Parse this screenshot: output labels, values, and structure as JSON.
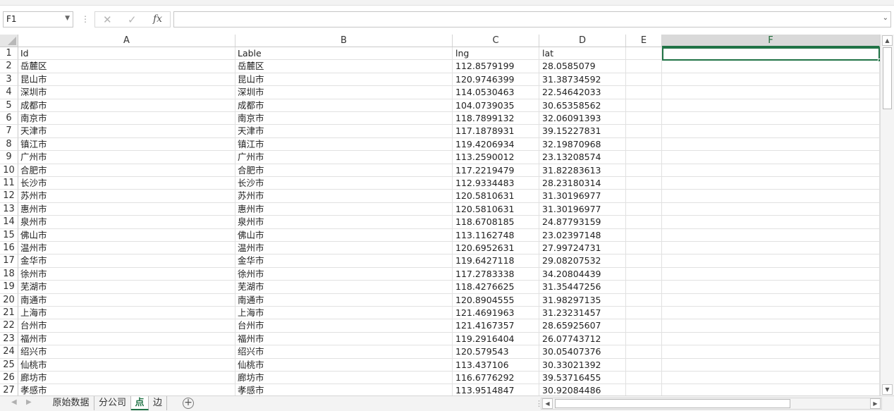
{
  "formula_bar": {
    "name_box": "F1",
    "fx_label": "fx",
    "formula_value": ""
  },
  "columns": [
    "A",
    "B",
    "C",
    "D",
    "E",
    "F"
  ],
  "active_column": "F",
  "rows": [
    {
      "num": "1",
      "a": "Id",
      "b": "Lable",
      "c": "lng",
      "d": "lat"
    },
    {
      "num": "2",
      "a": "岳麓区",
      "b": "岳麓区",
      "c": "112.8579199",
      "d": "28.0585079"
    },
    {
      "num": "3",
      "a": "昆山市",
      "b": "昆山市",
      "c": "120.9746399",
      "d": "31.38734592"
    },
    {
      "num": "4",
      "a": "深圳市",
      "b": "深圳市",
      "c": "114.0530463",
      "d": "22.54642033"
    },
    {
      "num": "5",
      "a": "成都市",
      "b": "成都市",
      "c": "104.0739035",
      "d": "30.65358562"
    },
    {
      "num": "6",
      "a": "南京市",
      "b": "南京市",
      "c": "118.7899132",
      "d": "32.06091393"
    },
    {
      "num": "7",
      "a": "天津市",
      "b": "天津市",
      "c": "117.1878931",
      "d": "39.15227831"
    },
    {
      "num": "8",
      "a": "镇江市",
      "b": "镇江市",
      "c": "119.4206934",
      "d": "32.19870968"
    },
    {
      "num": "9",
      "a": "广州市",
      "b": "广州市",
      "c": "113.2590012",
      "d": "23.13208574"
    },
    {
      "num": "10",
      "a": "合肥市",
      "b": "合肥市",
      "c": "117.2219479",
      "d": "31.82283613"
    },
    {
      "num": "11",
      "a": "长沙市",
      "b": "长沙市",
      "c": "112.9334483",
      "d": "28.23180314"
    },
    {
      "num": "12",
      "a": "苏州市",
      "b": "苏州市",
      "c": "120.5810631",
      "d": "31.30196977"
    },
    {
      "num": "13",
      "a": "惠州市",
      "b": "惠州市",
      "c": "120.5810631",
      "d": "31.30196977"
    },
    {
      "num": "14",
      "a": "泉州市",
      "b": "泉州市",
      "c": "118.6708185",
      "d": "24.87793159"
    },
    {
      "num": "15",
      "a": "佛山市",
      "b": "佛山市",
      "c": "113.1162748",
      "d": "23.02397148"
    },
    {
      "num": "16",
      "a": "温州市",
      "b": "温州市",
      "c": "120.6952631",
      "d": "27.99724731"
    },
    {
      "num": "17",
      "a": "金华市",
      "b": "金华市",
      "c": "119.6427118",
      "d": "29.08207532"
    },
    {
      "num": "18",
      "a": "徐州市",
      "b": "徐州市",
      "c": "117.2783338",
      "d": "34.20804439"
    },
    {
      "num": "19",
      "a": "芜湖市",
      "b": "芜湖市",
      "c": "118.4276625",
      "d": "31.35447256"
    },
    {
      "num": "20",
      "a": "南通市",
      "b": "南通市",
      "c": "120.8904555",
      "d": "31.98297135"
    },
    {
      "num": "21",
      "a": "上海市",
      "b": "上海市",
      "c": "121.4691963",
      "d": "31.23231457"
    },
    {
      "num": "22",
      "a": "台州市",
      "b": "台州市",
      "c": "121.4167357",
      "d": "28.65925607"
    },
    {
      "num": "23",
      "a": "福州市",
      "b": "福州市",
      "c": "119.2916404",
      "d": "26.07743712"
    },
    {
      "num": "24",
      "a": "绍兴市",
      "b": "绍兴市",
      "c": "120.579543",
      "d": "30.05407376"
    },
    {
      "num": "25",
      "a": "仙桃市",
      "b": "仙桃市",
      "c": "113.437106",
      "d": "30.33021392"
    },
    {
      "num": "26",
      "a": "廊坊市",
      "b": "廊坊市",
      "c": "116.6776292",
      "d": "39.53716455"
    },
    {
      "num": "27",
      "a": "孝感市",
      "b": "孝感市",
      "c": "113.9514847",
      "d": "30.92084486"
    }
  ],
  "sheet_tabs": [
    {
      "label": "原始数据",
      "active": false
    },
    {
      "label": "分公司",
      "active": false
    },
    {
      "label": "点",
      "active": true
    },
    {
      "label": "边",
      "active": false
    }
  ],
  "icons": {
    "cancel": "close-icon",
    "enter": "check-icon",
    "add_sheet": "plus-circle-icon"
  },
  "colors": {
    "accent": "#217346",
    "gridline": "#e1e1e1",
    "header_bg": "#ffffff",
    "active_header_bg": "#d9d9d9"
  }
}
